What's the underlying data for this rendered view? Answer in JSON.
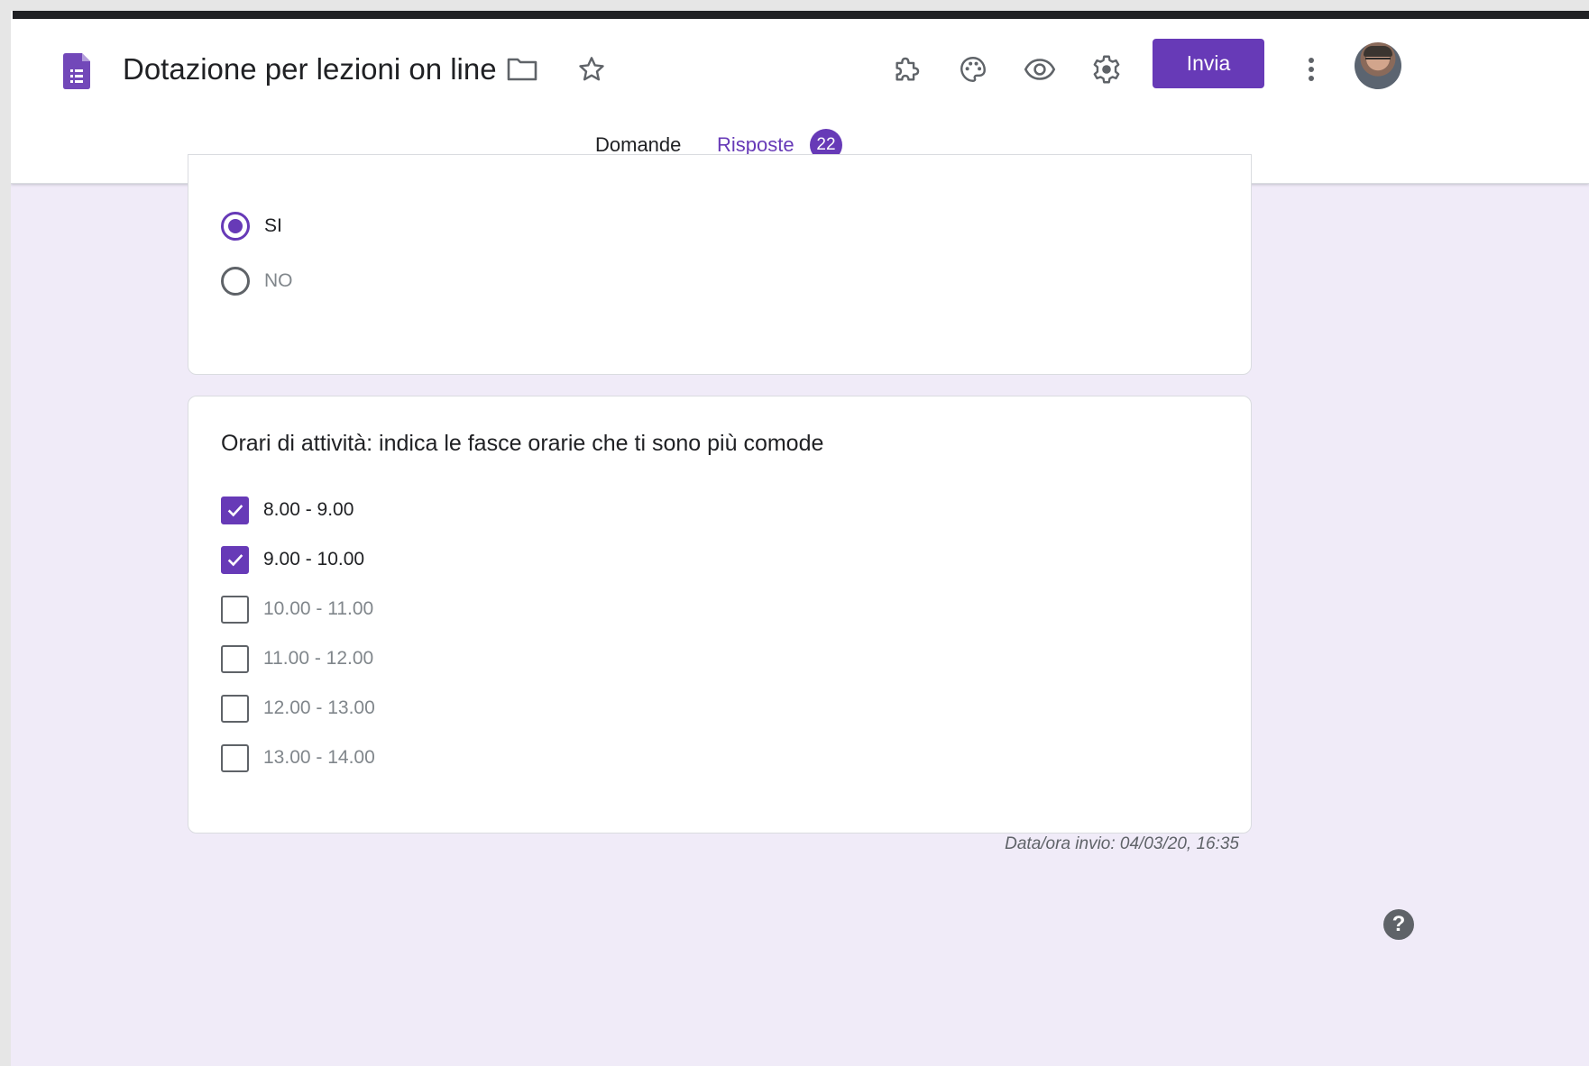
{
  "header": {
    "title": "Dotazione per lezioni on line (",
    "send_label": "Invia",
    "icons": [
      "forms-logo-icon",
      "folder-icon",
      "star-icon",
      "addons-icon",
      "palette-icon",
      "eye-icon",
      "gear-icon",
      "more-vert-icon",
      "avatar"
    ]
  },
  "tabs": {
    "questions": "Domande",
    "responses": "Risposte",
    "responses_count": "22"
  },
  "previous_question": {
    "options": [
      {
        "label": "SI",
        "selected": true
      },
      {
        "label": "NO",
        "selected": false
      }
    ]
  },
  "schedule_question": {
    "text": "Orari di attività: indica le fasce orarie che ti sono più comode",
    "options": [
      {
        "label": "8.00 - 9.00",
        "checked": true
      },
      {
        "label": "9.00 - 10.00",
        "checked": true
      },
      {
        "label": "10.00 - 11.00",
        "checked": false
      },
      {
        "label": "11.00 - 12.00",
        "checked": false
      },
      {
        "label": "12.00 - 13.00",
        "checked": false
      },
      {
        "label": "13.00 - 14.00",
        "checked": false
      }
    ]
  },
  "submission": {
    "timestamp": "Data/ora invio: 04/03/20, 16:35"
  },
  "help": {
    "symbol": "?"
  },
  "colors": {
    "accent": "#673ab7",
    "background": "#f0ebf8"
  }
}
